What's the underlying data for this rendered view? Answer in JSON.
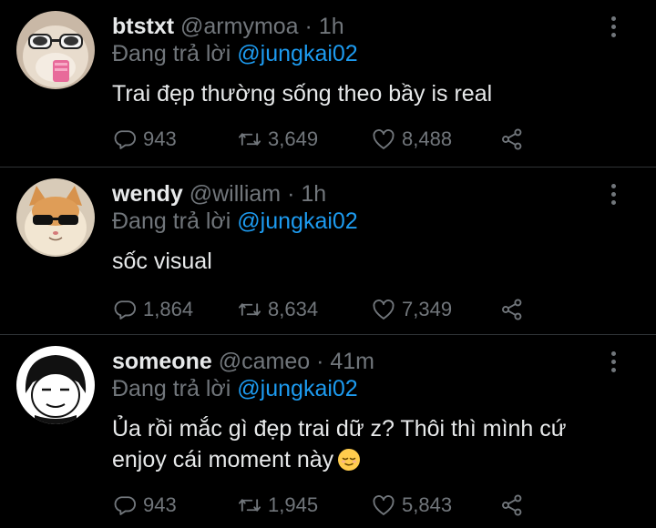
{
  "tweets": [
    {
      "name": "btstxt",
      "handle": "@armymoa",
      "time": "1h",
      "reply_prefix": "Đang trả lời",
      "reply_to": "@jungkai02",
      "text_lines": [
        "Trai đẹp thường sống theo bầy is real"
      ],
      "replies": "943",
      "retweets": "3,649",
      "likes": "8,488"
    },
    {
      "name": "wendy",
      "handle": "@william",
      "time": "1h",
      "reply_prefix": "Đang trả lời",
      "reply_to": "@jungkai02",
      "text_lines": [
        "sốc visual"
      ],
      "replies": "1,864",
      "retweets": "8,634",
      "likes": "7,349"
    },
    {
      "name": "someone",
      "handle": "@cameo",
      "time": "41m",
      "reply_prefix": "Đang trả lời",
      "reply_to": "@jungkai02",
      "text_lines": [
        "Ủa rồi mắc gì đẹp trai dữ z? Thôi thì mình cứ",
        "enjoy cái moment này"
      ],
      "emoji": "relieved-face-emoji",
      "replies": "943",
      "retweets": "1,945",
      "likes": "5,843"
    }
  ],
  "colors": {
    "background": "#000000",
    "text": "#e7e9ea",
    "muted": "#71767b",
    "mention": "#1d9bf0",
    "divider": "#2f3336"
  },
  "icons": [
    "reply-icon",
    "retweet-icon",
    "like-icon",
    "share-icon",
    "more-options-icon"
  ]
}
